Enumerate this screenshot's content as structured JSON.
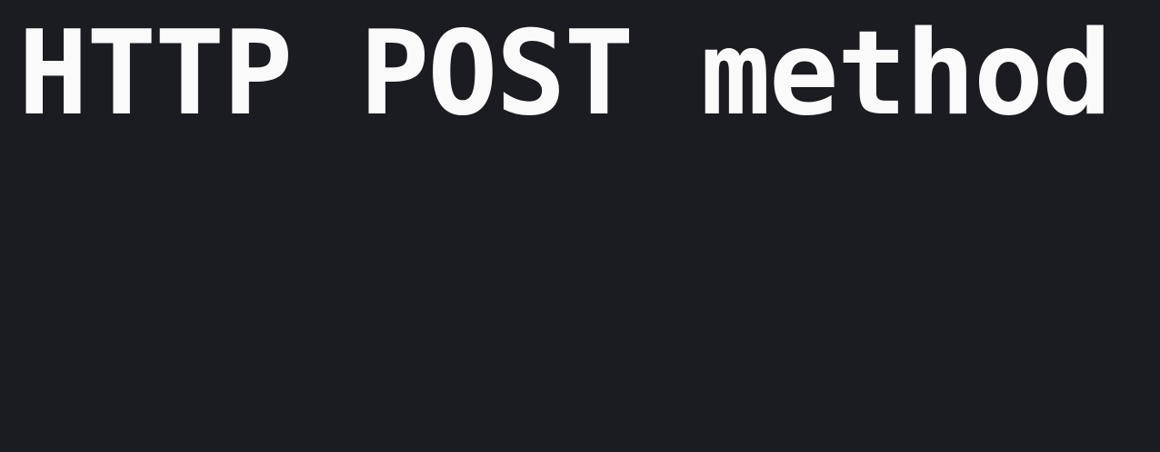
{
  "page": {
    "title": "HTTP POST method",
    "background_color": "#1b1c21",
    "text_color": "#fafafa"
  }
}
